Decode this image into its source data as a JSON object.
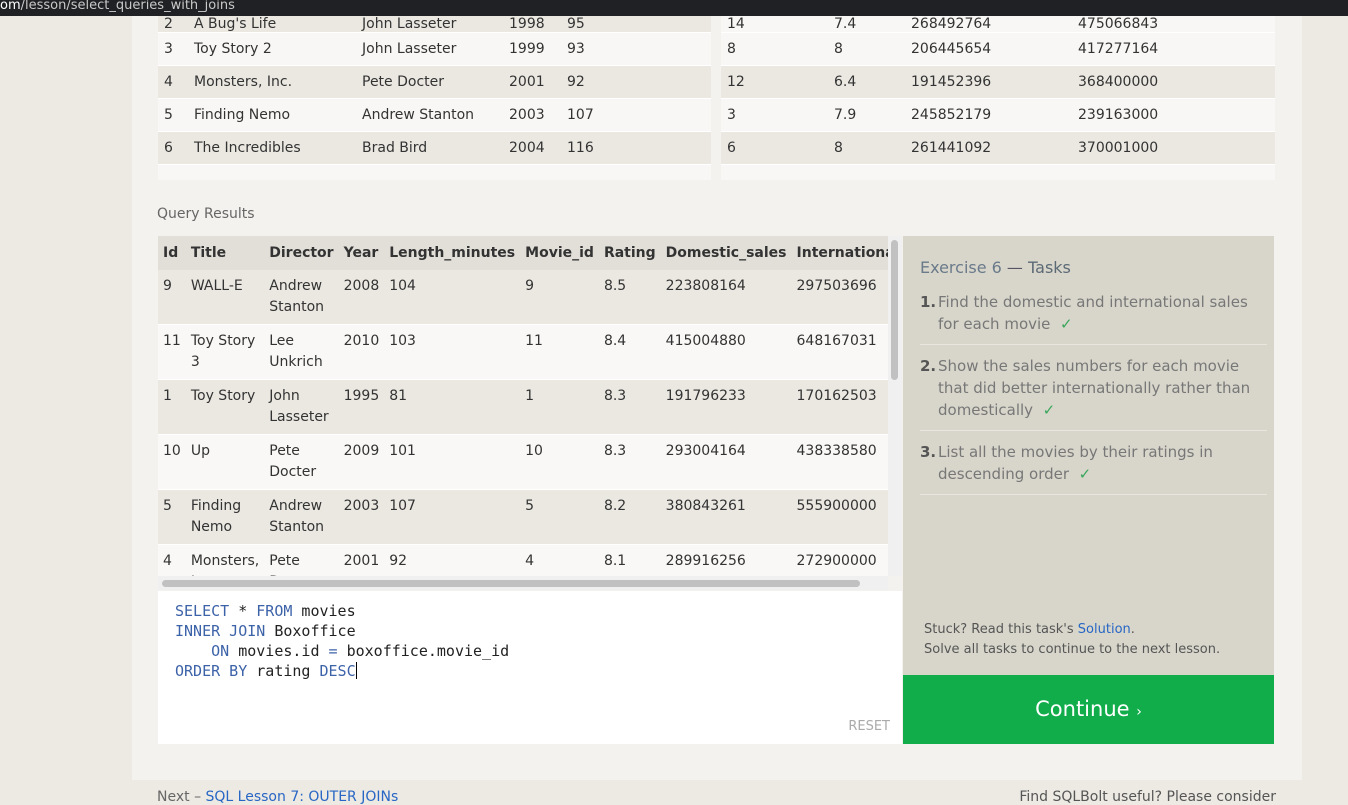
{
  "browser": {
    "url_host": "om",
    "url_path": "/lesson/select_queries_with_joins"
  },
  "movies_table": {
    "rows": [
      [
        "2",
        "A Bug's Life",
        "John Lasseter",
        "1998",
        "95"
      ],
      [
        "3",
        "Toy Story 2",
        "John Lasseter",
        "1999",
        "93"
      ],
      [
        "4",
        "Monsters, Inc.",
        "Pete Docter",
        "2001",
        "92"
      ],
      [
        "5",
        "Finding Nemo",
        "Andrew Stanton",
        "2003",
        "107"
      ],
      [
        "6",
        "The Incredibles",
        "Brad Bird",
        "2004",
        "116"
      ]
    ]
  },
  "boxoffice_table": {
    "rows": [
      [
        "14",
        "7.4",
        "268492764",
        "475066843"
      ],
      [
        "8",
        "8",
        "206445654",
        "417277164"
      ],
      [
        "12",
        "6.4",
        "191452396",
        "368400000"
      ],
      [
        "3",
        "7.9",
        "245852179",
        "239163000"
      ],
      [
        "6",
        "8",
        "261441092",
        "370001000"
      ]
    ]
  },
  "results": {
    "label": "Query Results",
    "headers": [
      "Id",
      "Title",
      "Director",
      "Year",
      "Length_minutes",
      "Movie_id",
      "Rating",
      "Domestic_sales",
      "International_sa"
    ],
    "rows": [
      [
        "9",
        "WALL-E",
        "Andrew Stanton",
        "2008",
        "104",
        "9",
        "8.5",
        "223808164",
        "297503696"
      ],
      [
        "11",
        "Toy Story 3",
        "Lee Unkrich",
        "2010",
        "103",
        "11",
        "8.4",
        "415004880",
        "648167031"
      ],
      [
        "1",
        "Toy Story",
        "John Lasseter",
        "1995",
        "81",
        "1",
        "8.3",
        "191796233",
        "170162503"
      ],
      [
        "10",
        "Up",
        "Pete Docter",
        "2009",
        "101",
        "10",
        "8.3",
        "293004164",
        "438338580"
      ],
      [
        "5",
        "Finding Nemo",
        "Andrew Stanton",
        "2003",
        "107",
        "5",
        "8.2",
        "380843261",
        "555900000"
      ],
      [
        "4",
        "Monsters, Inc.",
        "Pete Docter",
        "2001",
        "92",
        "4",
        "8.1",
        "289916256",
        "272900000"
      ]
    ]
  },
  "editor": {
    "line1_kw1": "SELECT",
    "line1_mid": " * ",
    "line1_kw2": "FROM",
    "line1_rest": " movies",
    "line2_kw": "INNER JOIN",
    "line2_rest": " Boxoffice",
    "line3_kw": "ON",
    "line3_a": " movies.id ",
    "line3_eq": "=",
    "line3_b": " boxoffice.movie_id",
    "line4_kw": "ORDER BY",
    "line4_mid": " rating ",
    "line4_kw2": "DESC",
    "reset_label": "RESET"
  },
  "tasks": {
    "exercise": "Exercise 6",
    "dash": " — ",
    "title": "Tasks",
    "items": [
      {
        "num": "1.",
        "text": "Find the domestic and international sales for each movie",
        "check": "✓"
      },
      {
        "num": "2.",
        "text": "Show the sales numbers for each movie that did better internationally rather than domestically",
        "check": "✓"
      },
      {
        "num": "3.",
        "text": "List all the movies by their ratings in descending order",
        "check": "✓"
      }
    ],
    "stuck_prefix": "Stuck? Read this task's ",
    "solution_link": "Solution",
    "stuck_suffix": ".",
    "solve_all": "Solve all tasks to continue to the next lesson."
  },
  "continue": {
    "label": "Continue",
    "chevron": "›"
  },
  "footer": {
    "next_prefix": "Next – ",
    "next_link": "SQL Lesson 7: OUTER JOINs",
    "useful": "Find SQLBolt useful? Please consider"
  }
}
